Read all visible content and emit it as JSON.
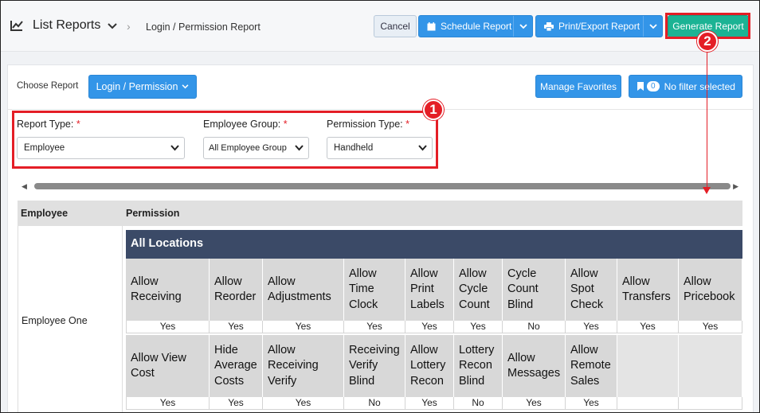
{
  "header": {
    "title": "List Reports",
    "breadcrumb": "Login / Permission Report",
    "cancel_label": "Cancel",
    "schedule_label": "Schedule Report",
    "print_label": "Print/Export Report",
    "generate_label": "Generate Report"
  },
  "toolbar": {
    "choose_label": "Choose Report",
    "report_button": "Login / Permission",
    "favorites_label": "Manage Favorites",
    "filter_count": "0",
    "filter_label": "No filter selected"
  },
  "filters": {
    "report_type": {
      "label": "Report Type:",
      "required": "*",
      "value": "Employee"
    },
    "employee_group": {
      "label": "Employee Group:",
      "required": "*",
      "value": "All Employee Group"
    },
    "permission_type": {
      "label": "Permission Type:",
      "required": "*",
      "value": "Handheld"
    }
  },
  "annotations": {
    "badge1": "1",
    "badge2": "2"
  },
  "table": {
    "col_employee": "Employee",
    "col_permission": "Permission",
    "employee_name": "Employee One",
    "location_title": "All Locations",
    "row1": {
      "labels": [
        "Allow Receiving",
        "Allow Reorder",
        "Allow Adjustments",
        "Allow Time Clock",
        "Allow Print Labels",
        "Allow Cycle Count",
        "Cycle Count Blind",
        "Allow Spot Check",
        "Allow Transfers",
        "Allow Pricebook"
      ],
      "values": [
        "Yes",
        "Yes",
        "Yes",
        "Yes",
        "Yes",
        "Yes",
        "No",
        "Yes",
        "Yes",
        "Yes"
      ]
    },
    "row2": {
      "labels": [
        "Allow View Cost",
        "Hide Average Costs",
        "Allow Receiving Verify",
        "Receiving Verify Blind",
        "Allow Lottery Recon",
        "Lottery Recon Blind",
        "Allow Messages",
        "Allow Remote Sales",
        "",
        ""
      ],
      "values": [
        "Yes",
        "Yes",
        "Yes",
        "No",
        "Yes",
        "No",
        "Yes",
        "Yes",
        "",
        ""
      ]
    }
  }
}
